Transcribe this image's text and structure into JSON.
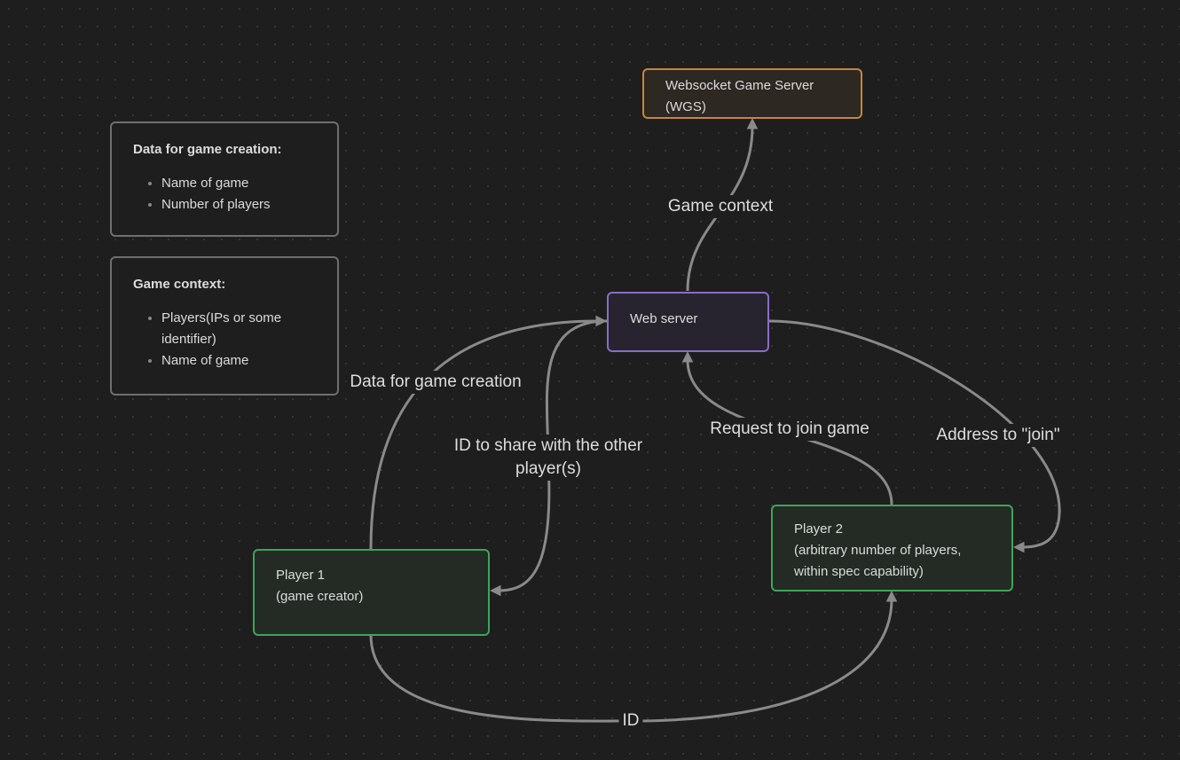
{
  "colors": {
    "background": "#1e1e1e",
    "edge": "#8a8a8a",
    "orange": "#c7853a",
    "purple": "#8a6cc6",
    "green": "#3fa45a",
    "gray": "#6f6f6f"
  },
  "notes": [
    {
      "title": "Data for game creation:",
      "items": [
        "Name of game",
        "Number of players"
      ]
    },
    {
      "title": "Game context:",
      "items": [
        "Players(IPs or some identifier)",
        "Name of game"
      ]
    }
  ],
  "nodes": {
    "wgs": "Websocket Game Server\n(WGS)",
    "web_server": "Web server",
    "player1": "Player 1\n(game creator)",
    "player2": "Player 2\n(arbitrary number of players,\nwithin spec capability)"
  },
  "edges": [
    {
      "from": "Web server",
      "to": "Websocket Game Server (WGS)",
      "label": "Game context"
    },
    {
      "from": "Player 1",
      "to": "Web server",
      "label": "Data for game creation"
    },
    {
      "from": "Web server",
      "to": "Player 1",
      "label": "ID to share with the other\nplayer(s)"
    },
    {
      "from": "Player 2",
      "to": "Web server",
      "label": "Request to join game"
    },
    {
      "from": "Web server",
      "to": "Player 2",
      "label": "Address to \"join\""
    },
    {
      "from": "Player 1",
      "to": "Player 2",
      "label": "ID"
    }
  ]
}
